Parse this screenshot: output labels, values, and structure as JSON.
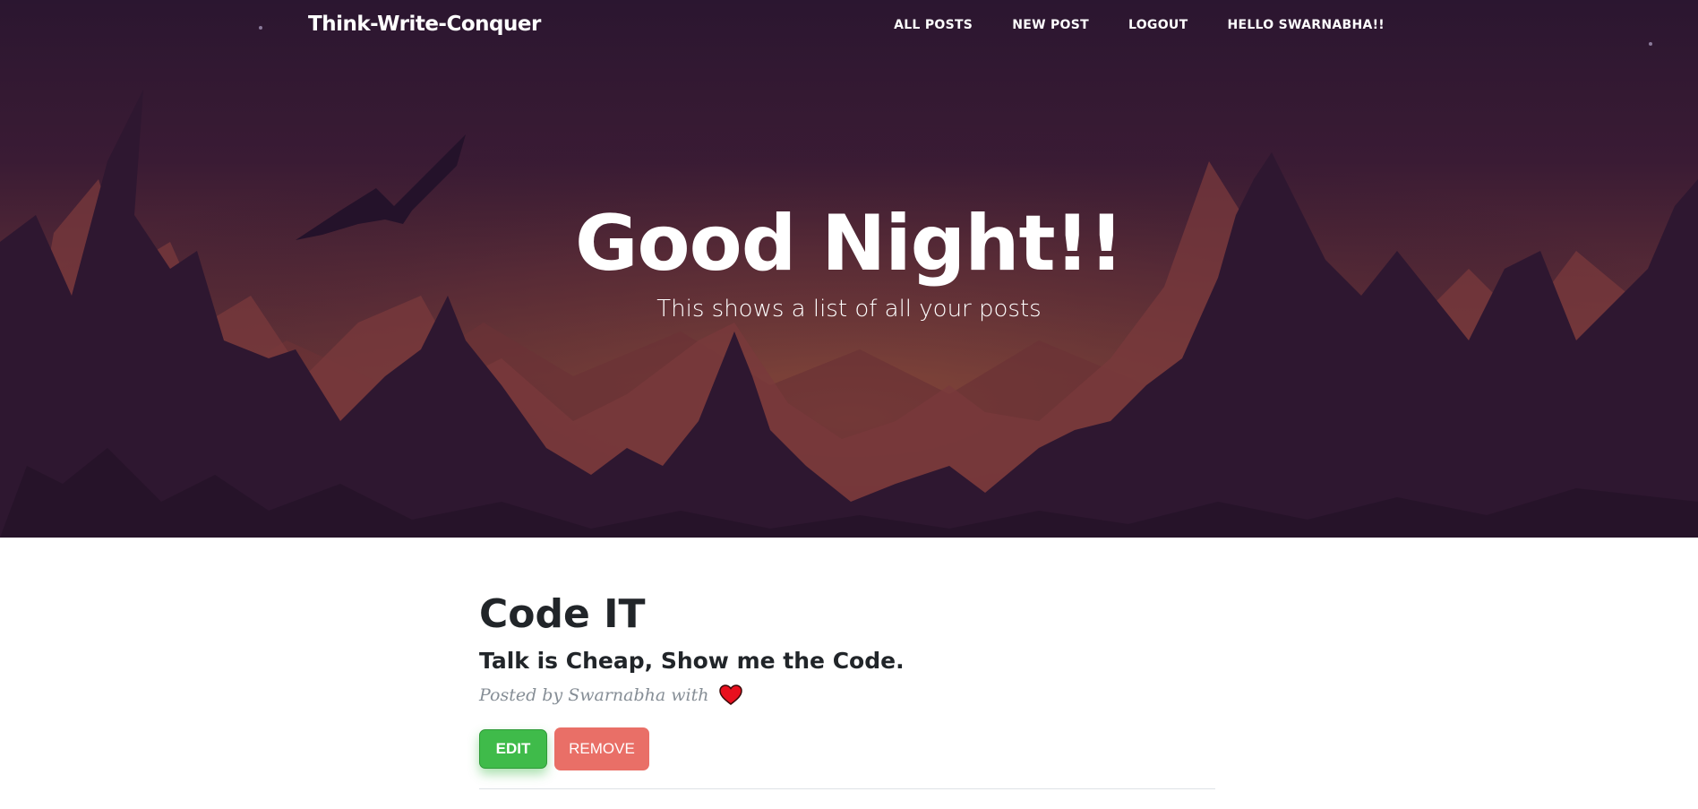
{
  "navbar": {
    "brand": "Think-Write-Conquer",
    "links": [
      "ALL POSTS",
      "NEW POST",
      "LOGOUT",
      "HELLO SWARNABHA!!"
    ]
  },
  "hero": {
    "title": "Good Night!!",
    "subtitle": "This shows a list of all your posts"
  },
  "post": {
    "title": "Code IT",
    "subtitle": "Talk is Cheap, Show me the Code.",
    "meta": "Posted by Swarnabha with",
    "edit_label": "EDIT",
    "remove_label": "REMOVE"
  },
  "colors": {
    "edit": "#3fbb4a",
    "remove": "#e8685f",
    "heart": "#e8101e"
  }
}
